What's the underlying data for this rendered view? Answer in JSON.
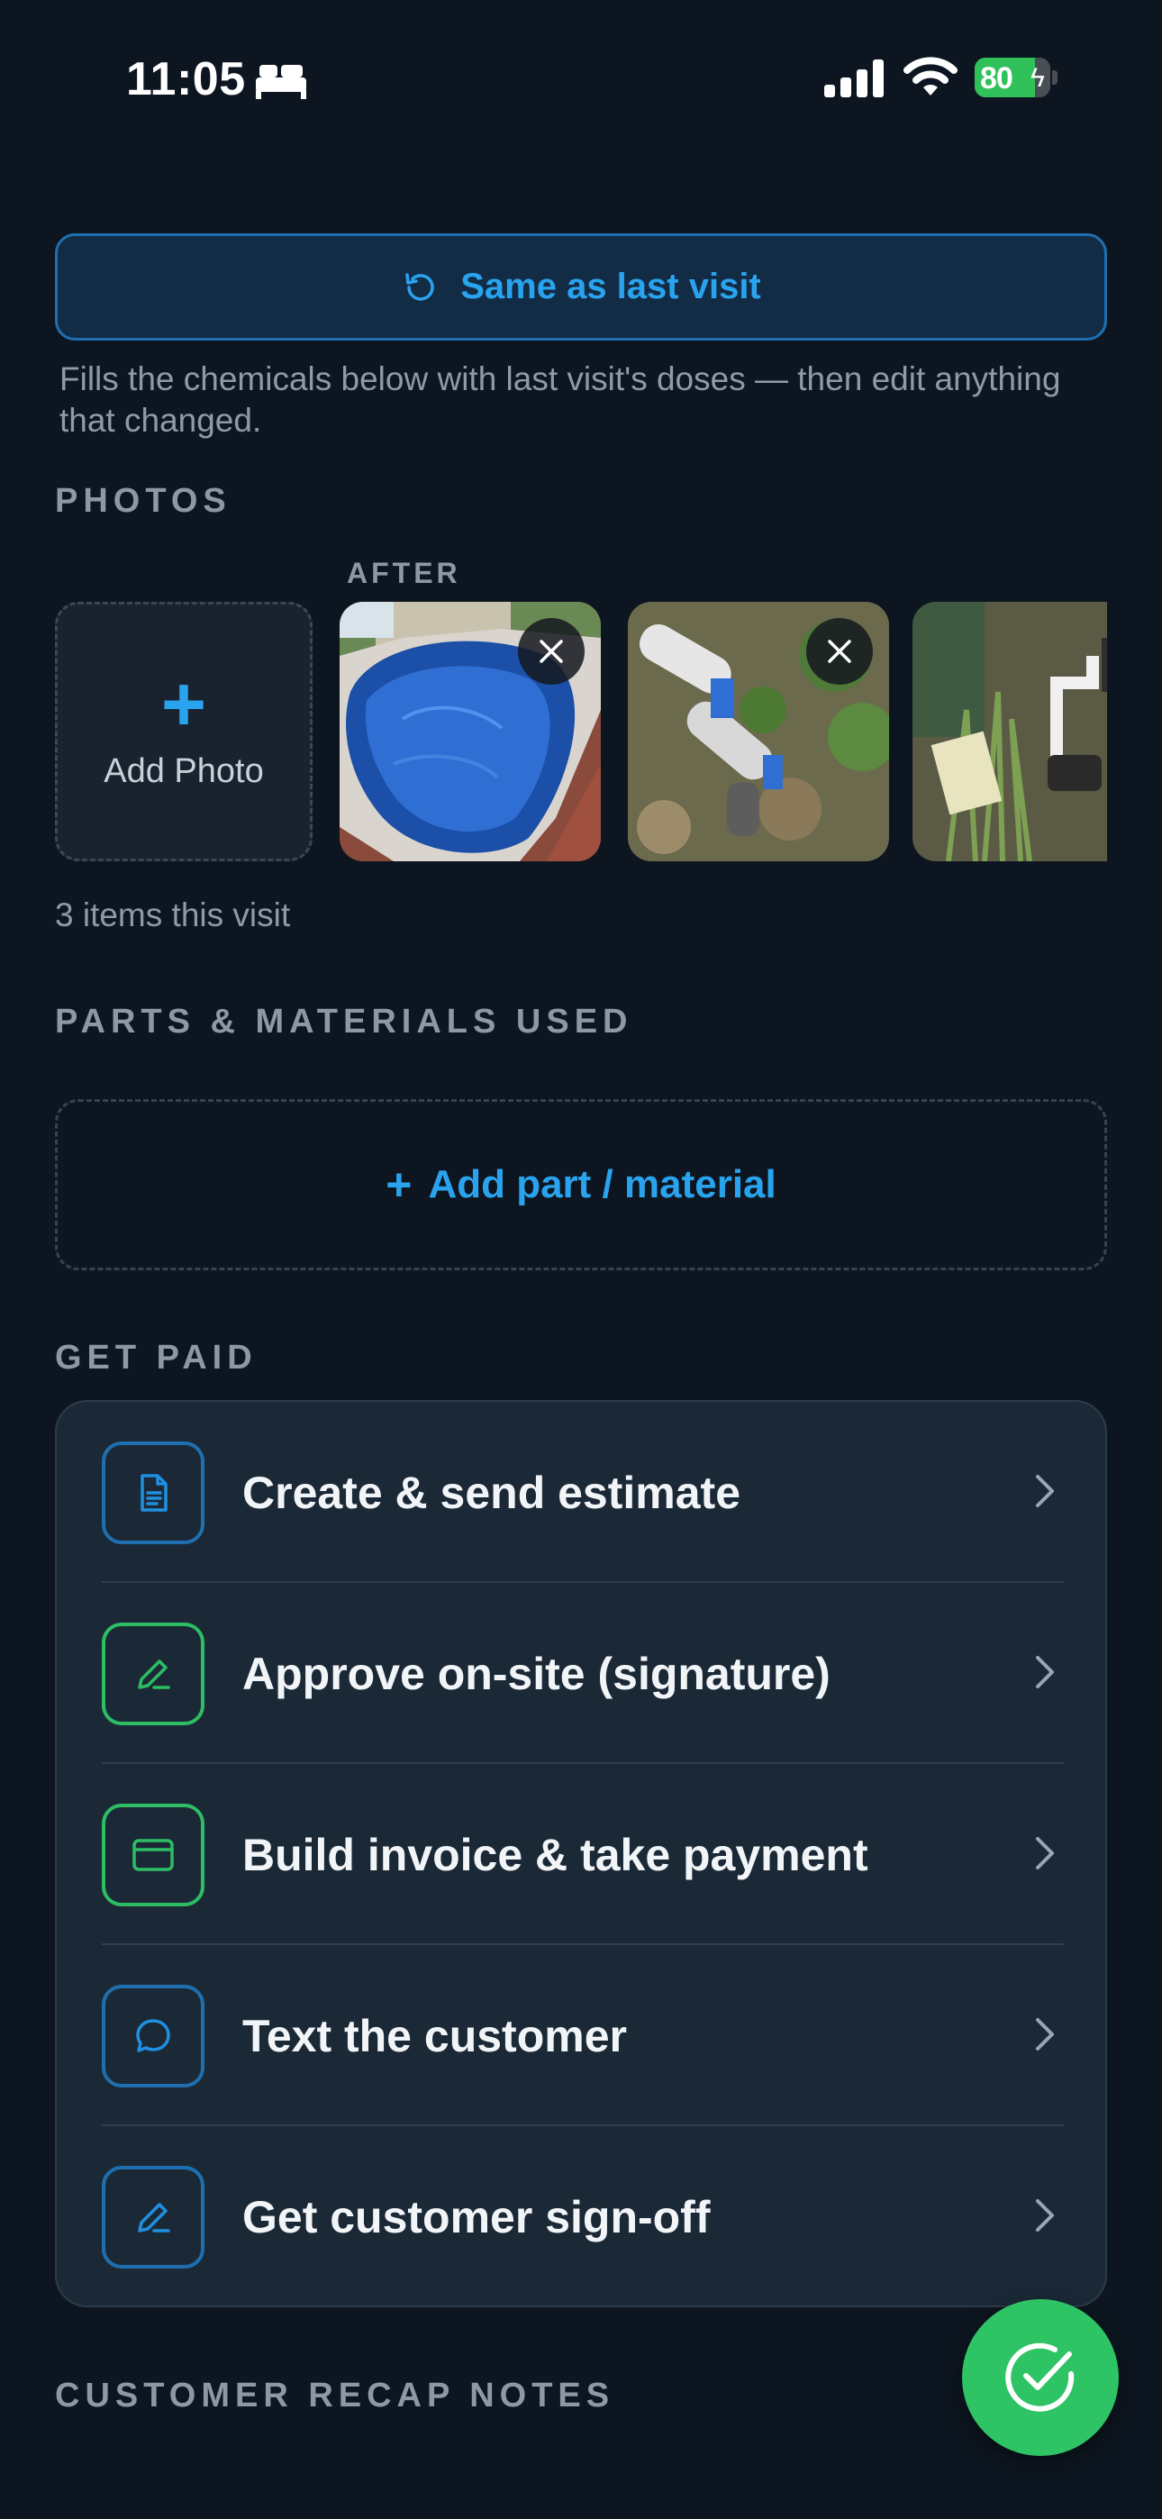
{
  "status_bar": {
    "time": "11:05",
    "battery": "80",
    "battery_level": 0.8
  },
  "same_visit": {
    "label": "Same as last visit",
    "help": "Fills the chemicals below with last visit's doses — then edit anything that changed."
  },
  "photos": {
    "heading": "PHOTOS",
    "group_label": "AFTER",
    "add_label": "Add Photo",
    "items_count": "3 items this visit"
  },
  "parts": {
    "heading": "PARTS & MATERIALS USED",
    "add_label": "Add part / material"
  },
  "get_paid": {
    "heading": "GET PAID",
    "items": [
      {
        "label": "Create & send estimate",
        "icon": "document-icon",
        "color": "#1f6fb0"
      },
      {
        "label": "Approve on-site (signature)",
        "icon": "pen-icon",
        "color": "#2dbd63"
      },
      {
        "label": "Build invoice & take payment",
        "icon": "card-icon",
        "color": "#2dbd63"
      },
      {
        "label": "Text the customer",
        "icon": "chat-icon",
        "color": "#1f6fb0"
      },
      {
        "label": "Get customer sign-off",
        "icon": "pen-icon",
        "color": "#1f6fb0"
      }
    ]
  },
  "recap": {
    "heading": "CUSTOMER RECAP NOTES"
  },
  "colors": {
    "accent": "#2aa3ef",
    "success": "#2ec465",
    "background": "#0d1620"
  }
}
